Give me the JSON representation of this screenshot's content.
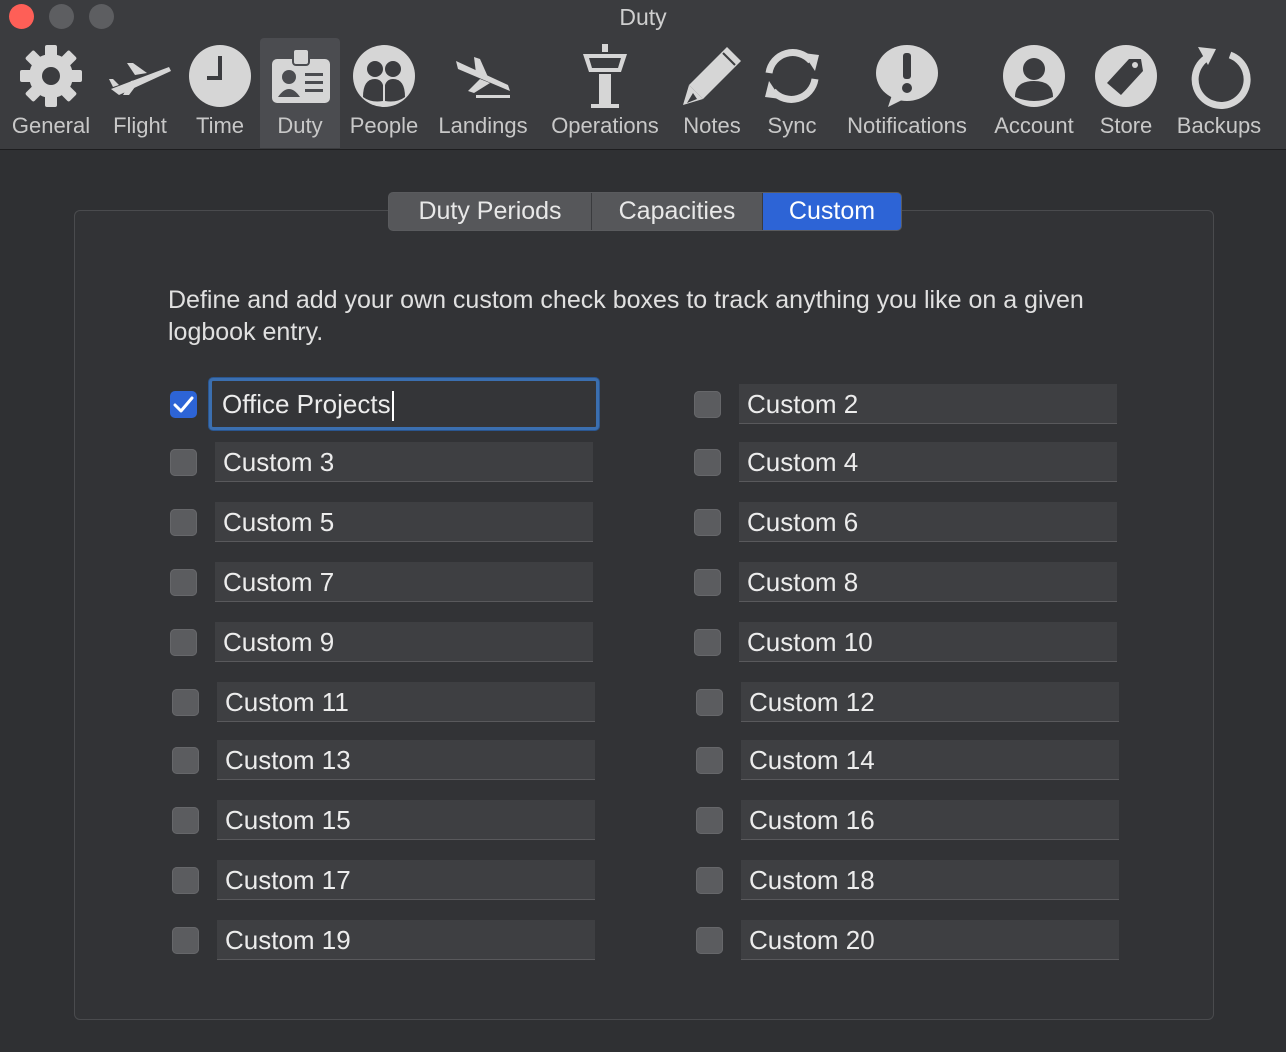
{
  "window": {
    "title": "Duty"
  },
  "toolbar": {
    "items": [
      {
        "label": "General",
        "icon": "gear-icon"
      },
      {
        "label": "Flight",
        "icon": "airplane-icon"
      },
      {
        "label": "Time",
        "icon": "clock-icon"
      },
      {
        "label": "Duty",
        "icon": "id-badge-icon",
        "selected": true
      },
      {
        "label": "People",
        "icon": "people-icon"
      },
      {
        "label": "Landings",
        "icon": "landing-plane-icon"
      },
      {
        "label": "Operations",
        "icon": "control-tower-icon"
      },
      {
        "label": "Notes",
        "icon": "pencil-icon"
      },
      {
        "label": "Sync",
        "icon": "sync-icon"
      },
      {
        "label": "Notifications",
        "icon": "exclamation-bubble-icon"
      },
      {
        "label": "Account",
        "icon": "person-icon"
      },
      {
        "label": "Store",
        "icon": "tag-icon"
      },
      {
        "label": "Backups",
        "icon": "backup-icon"
      }
    ]
  },
  "tabs": [
    {
      "label": "Duty Periods",
      "active": false
    },
    {
      "label": "Capacities",
      "active": false
    },
    {
      "label": "Custom",
      "active": true
    }
  ],
  "intro_text": "Define and add your own custom check boxes to track anything you like on a given logbook entry.",
  "fields": [
    {
      "value": "Office Projects",
      "checked": true
    },
    {
      "value": "Custom 2",
      "checked": false
    },
    {
      "value": "Custom 3",
      "checked": false
    },
    {
      "value": "Custom 4",
      "checked": false
    },
    {
      "value": "Custom 5",
      "checked": false
    },
    {
      "value": "Custom 6",
      "checked": false
    },
    {
      "value": "Custom 7",
      "checked": false
    },
    {
      "value": "Custom 8",
      "checked": false
    },
    {
      "value": "Custom 9",
      "checked": false
    },
    {
      "value": "Custom 10",
      "checked": false
    },
    {
      "value": "Custom 11",
      "checked": false
    },
    {
      "value": "Custom 12",
      "checked": false
    },
    {
      "value": "Custom 13",
      "checked": false
    },
    {
      "value": "Custom 14",
      "checked": false
    },
    {
      "value": "Custom 15",
      "checked": false
    },
    {
      "value": "Custom 16",
      "checked": false
    },
    {
      "value": "Custom 17",
      "checked": false
    },
    {
      "value": "Custom 18",
      "checked": false
    },
    {
      "value": "Custom 19",
      "checked": false
    },
    {
      "value": "Custom 20",
      "checked": false
    }
  ],
  "colors": {
    "accent": "#2d64d6",
    "close": "#fe5f57",
    "background": "#2f3033"
  }
}
